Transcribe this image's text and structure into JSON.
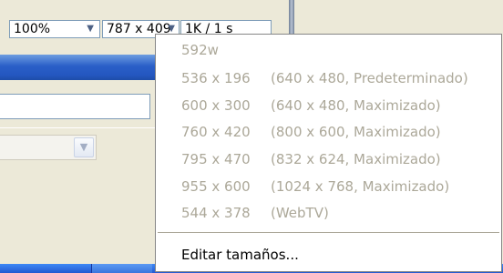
{
  "statusbar": {
    "zoom": "100%",
    "window_size": "787 x 409",
    "download": "1K / 1 s"
  },
  "menu": {
    "items": [
      {
        "size": "592w",
        "desc": ""
      },
      {
        "size": "536 x 196",
        "desc": "(640 x 480, Predeterminado)"
      },
      {
        "size": "600 x 300",
        "desc": "(640 x 480, Maximizado)"
      },
      {
        "size": "760 x 420",
        "desc": "(800 x 600, Maximizado)"
      },
      {
        "size": "795 x 470",
        "desc": "(832 x 624, Maximizado)"
      },
      {
        "size": "955 x 600",
        "desc": "(1024 x 768, Maximizado)"
      },
      {
        "size": "544 x 378",
        "desc": "(WebTV)"
      }
    ],
    "edit_sizes": "Editar tamaños..."
  },
  "icons": {
    "dropdown": "chevron-down-icon"
  },
  "colors": {
    "disabled_text": "#aca899",
    "menu_bg": "#ffffff",
    "titlebar": "#2457c0"
  }
}
